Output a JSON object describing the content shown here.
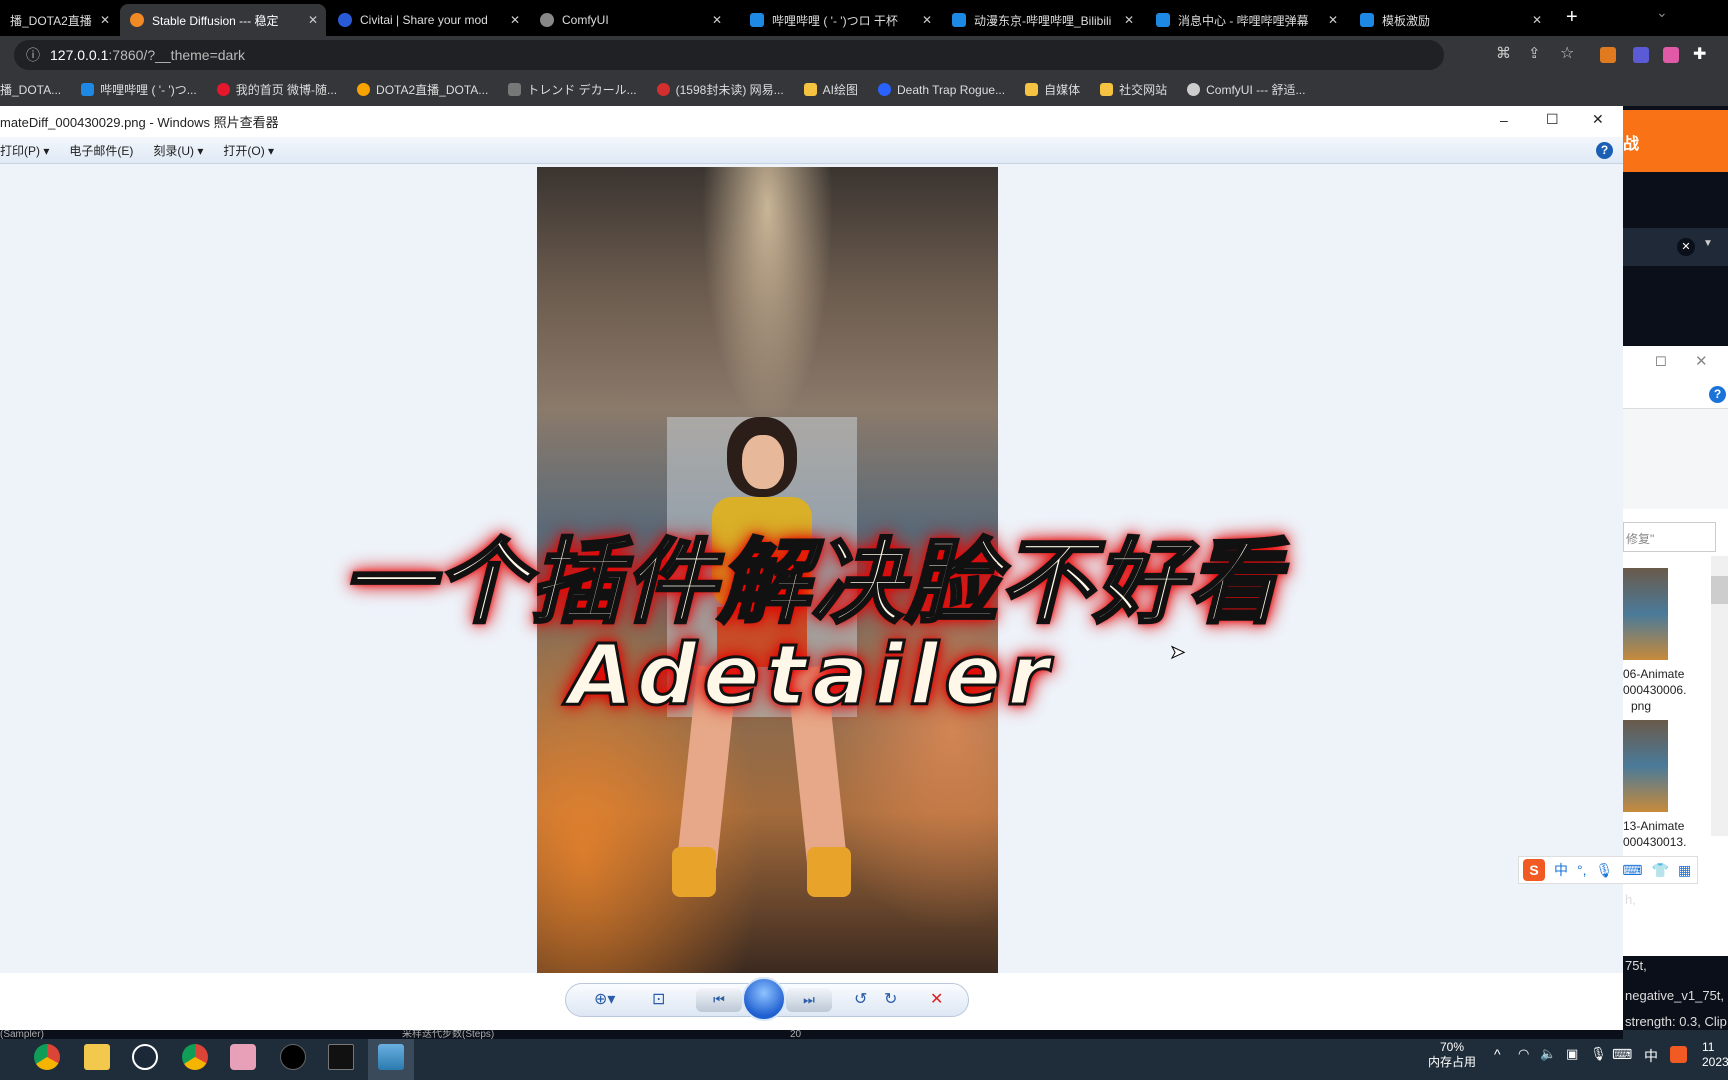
{
  "browser": {
    "tabs": [
      {
        "label": "播_DOTA2直播",
        "icon": "bilibili-icon",
        "color": "#222"
      },
      {
        "label": "Stable Diffusion --- 稳定",
        "icon": "stable-diffusion-icon",
        "color": "#f08a24",
        "active": true
      },
      {
        "label": "Civitai | Share your mod",
        "icon": "civitai-icon",
        "color": "#2a5bd7"
      },
      {
        "label": "ComfyUI",
        "icon": "globe-icon",
        "color": "#888"
      },
      {
        "label": "哔哩哔哩 ( '- ')つロ 干杯",
        "icon": "bilibili-icon",
        "color": "#1e88e5"
      },
      {
        "label": "动漫东京-哔哩哔哩_Bilibili",
        "icon": "bilibili-icon",
        "color": "#1e88e5"
      },
      {
        "label": "消息中心 - 哔哩哔哩弹幕",
        "icon": "bilibili-icon",
        "color": "#1e88e5"
      },
      {
        "label": "模板激励",
        "icon": "bilibili-icon",
        "color": "#1e88e5"
      }
    ],
    "new_tab": "+",
    "url_host": "127.0.0.1",
    "url_rest": ":7860/?__theme=dark",
    "bookmarks": [
      {
        "label": "播_DOTA...",
        "color": "#888"
      },
      {
        "label": "哔哩哔哩 ( '- ')つ...",
        "color": "#1e88e5"
      },
      {
        "label": "我的首页 微博-随...",
        "color": "#e6162d"
      },
      {
        "label": "DOTA2直播_DOTA...",
        "color": "#f7a400"
      },
      {
        "label": "トレンド デカール...",
        "color": "#777"
      },
      {
        "label": "(1598封未读) 网易...",
        "color": "#d32f2f"
      },
      {
        "label": "AI绘图",
        "color": "#f5c242"
      },
      {
        "label": "Death Trap Rogue...",
        "color": "#2962ff"
      },
      {
        "label": "自媒体",
        "color": "#f5c242"
      },
      {
        "label": "社交网站",
        "color": "#f5c242"
      },
      {
        "label": "ComfyUI --- 舒适...",
        "color": "#ccc"
      }
    ]
  },
  "viewer": {
    "title": "mateDiff_000430029.png - Windows 照片查看器",
    "menu": [
      "打印(P) ▾",
      "电子邮件(E)",
      "刻录(U) ▾",
      "打开(O) ▾"
    ],
    "help": "?",
    "controls": {
      "min": "–",
      "max": "☐",
      "close": "✕"
    }
  },
  "overlay": {
    "line1": "一个插件解决脸不好看",
    "line2": "Adetailer"
  },
  "right_panel": {
    "orange_text": "战",
    "search_text": "修复\"",
    "thumbs": [
      {
        "line1": "06-Animate",
        "line2": "000430006.",
        "line3": "png"
      },
      {
        "line1": "13-Animate",
        "line2": "000430013.",
        "line3": ""
      }
    ],
    "prompt_lines": [
      "h,",
      "75t,",
      "negative_v1_75t,",
      "strength: 0.3, Clip"
    ]
  },
  "strip": {
    "left": "(Sampler)",
    "mid": "采样迭代步数(Steps)",
    "value": "20"
  },
  "taskbar": {
    "memory_percent": "70%",
    "memory_label": "内存占用",
    "ime": "中",
    "clock": "11",
    "date": "2023"
  },
  "ime_bar": {
    "label": "中",
    "punct": "°,"
  }
}
